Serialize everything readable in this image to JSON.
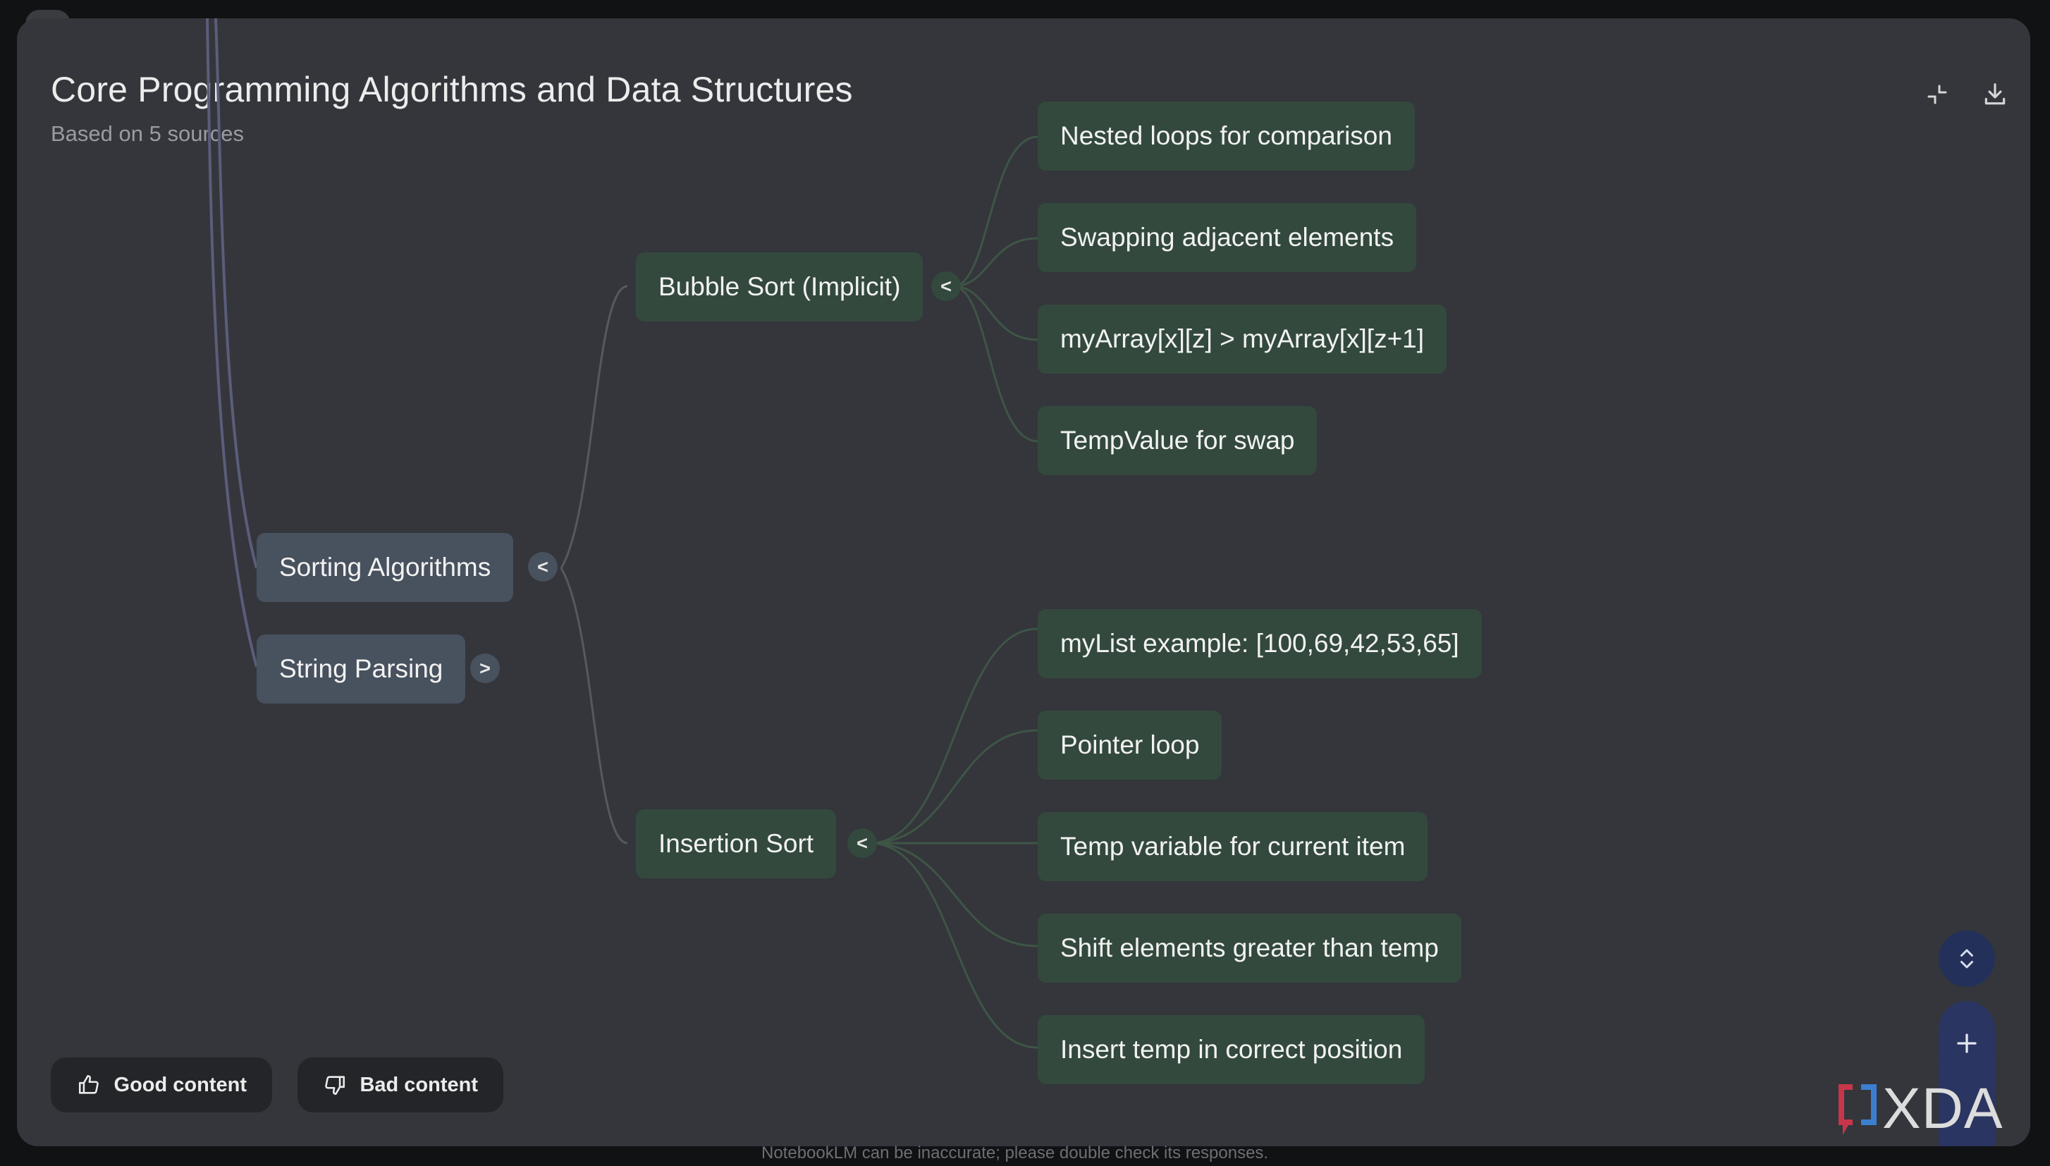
{
  "header": {
    "title": "Core Programming Algorithms and Data Structures",
    "subtitle": "Based on 5 sources"
  },
  "toolbar": {
    "collapse_icon": "collapse-icon",
    "download_icon": "download-icon"
  },
  "mindmap": {
    "level1": [
      {
        "label": "Sorting Algorithms",
        "toggle": "<"
      },
      {
        "label": "String Parsing",
        "toggle": ">"
      }
    ],
    "level2": [
      {
        "label": "Bubble Sort (Implicit)",
        "toggle": "<"
      },
      {
        "label": "Insertion Sort",
        "toggle": "<"
      }
    ],
    "bubble_children": [
      "Nested loops for comparison",
      "Swapping adjacent elements",
      "myArray[x][z] > myArray[x][z+1]",
      "TempValue for swap"
    ],
    "insertion_children": [
      "myList example: [100,69,42,53,65]",
      "Pointer loop",
      "Temp variable for current item",
      "Shift elements greater than temp",
      "Insert temp in correct position"
    ]
  },
  "feedback": {
    "good_label": "Good content",
    "bad_label": "Bad content"
  },
  "controls": {
    "expand_icon": "expand-collapse-icon",
    "zoom_in_icon": "plus-icon"
  },
  "footer": {
    "disclaimer": "NotebookLM can be inaccurate; please double check its responses."
  },
  "watermark": {
    "text": "XDA"
  },
  "colors": {
    "panel": "#34363b",
    "slate_node": "#48515e",
    "green_node": "#33493d",
    "zoom_button": "#23305a"
  }
}
